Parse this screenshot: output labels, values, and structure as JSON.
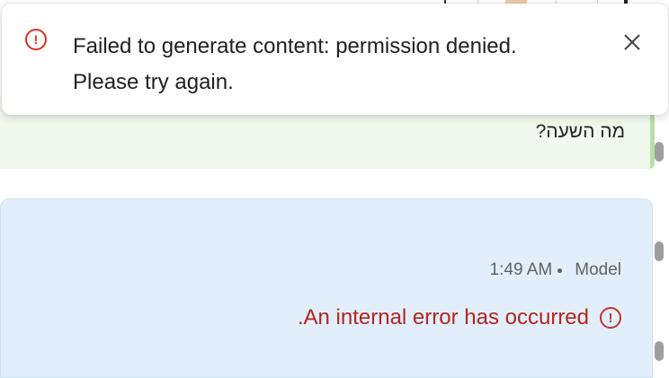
{
  "toast": {
    "icon": "error-circle-icon",
    "line1": "Failed to generate content: permission denied.",
    "line2": "Please try again.",
    "close_icon": "close-icon",
    "error_color": "#d93025"
  },
  "user_message": {
    "text": "מה השעה?"
  },
  "model_message": {
    "time": "1:49 AM",
    "role": "Model",
    "error_text": "An internal error has occurred.",
    "error_icon": "error-circle-icon",
    "error_color": "#b3261e"
  },
  "colors": {
    "user_bg": "#f1f8ee",
    "model_bg": "#e2effb"
  }
}
